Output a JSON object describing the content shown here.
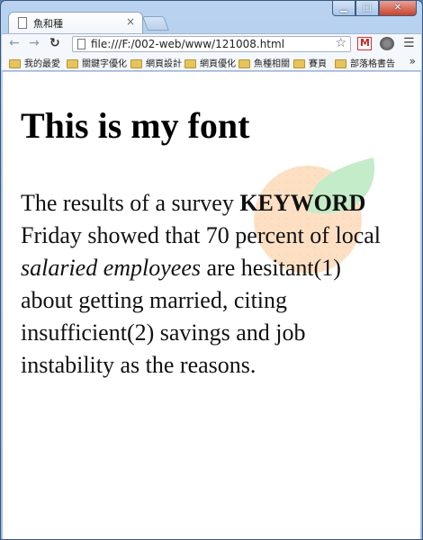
{
  "browser": {
    "tab_title": "魚和種",
    "tab_close": "×",
    "url": "file:///F:/002-web/www/121008.html",
    "back_icon": "arrow-left-icon",
    "forward_icon": "arrow-right-icon",
    "reload_icon": "reload-icon",
    "star_icon": "star-icon",
    "menu_icon": "menu-icon",
    "window_buttons": {
      "minimize": "▁",
      "maximize": "□",
      "close": "✕"
    }
  },
  "bookmarks": [
    {
      "label": "我的最愛"
    },
    {
      "label": "關鍵字優化"
    },
    {
      "label": "網頁設計"
    },
    {
      "label": "網頁優化"
    },
    {
      "label": "魚種相關"
    },
    {
      "label": "賽頁"
    },
    {
      "label": "部落格書告"
    }
  ],
  "bookmarks_more": "»",
  "page": {
    "heading": "This is my font",
    "paragraph": {
      "part1": "The results of a survey ",
      "keyword": "KEYWORD",
      "part2": " Friday showed that 70 percent of local ",
      "italic": "salaried employees",
      "part3": " are hesitant(1) about getting married, citing insufficient(2) savings and job instability as the reasons."
    }
  },
  "colors": {
    "frame": "#a8c5ea",
    "deco_orange": "#fde0c4",
    "deco_green": "#c4ecc8"
  }
}
